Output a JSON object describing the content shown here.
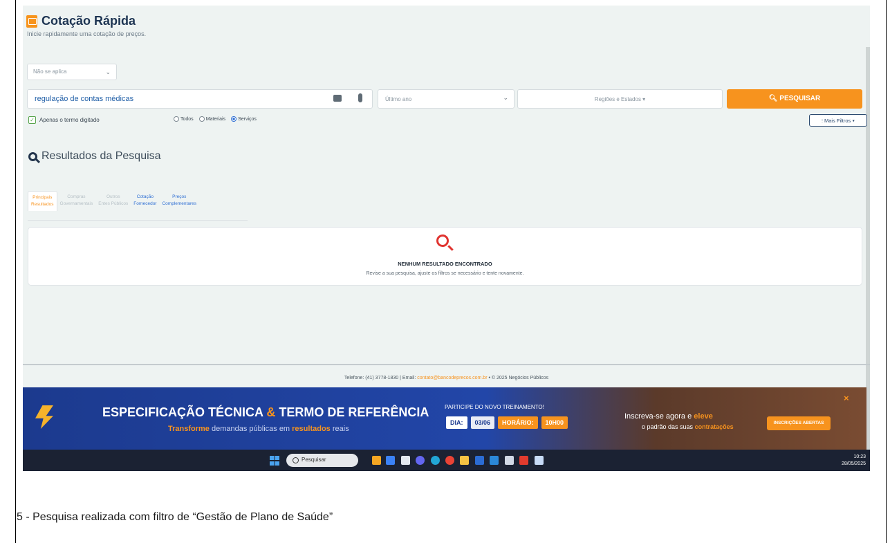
{
  "header": {
    "title": "Cotação Rápida",
    "subtitle": "Inicie rapidamente uma cotação de preços."
  },
  "filters": {
    "applicability": "Não se aplica",
    "search_value": "regulação de contas médicas",
    "period": "Último ano",
    "regions": "Regiões e Estados ▾",
    "search_button": "PESQUISAR",
    "exact_term_label": "Apenas o termo digitado",
    "exact_term_checked": true,
    "radio_options": [
      {
        "label": "Todos",
        "selected": false
      },
      {
        "label": "Materiais",
        "selected": false
      },
      {
        "label": "Serviços",
        "selected": true
      }
    ],
    "more_filters": "Mais Filtros ▾"
  },
  "results": {
    "heading": "Resultados da Pesquisa",
    "tabs": [
      {
        "line1": "Principais",
        "line2": "Resultados",
        "state": "active"
      },
      {
        "line1": "Compras",
        "line2": "Governamentais",
        "state": "disabled"
      },
      {
        "line1": "Outros",
        "line2": "Entes Públicos",
        "state": "disabled"
      },
      {
        "line1": "Cotação",
        "line2": "Fornecedor",
        "state": "link"
      },
      {
        "line1": "Preços",
        "line2": "Complementares",
        "state": "link"
      }
    ],
    "empty_title": "NENHUM RESULTADO ENCONTRADO",
    "empty_message": "Revise a sua pesquisa, ajuste os filtros se necessário e tente novamente."
  },
  "footer": {
    "contact_prefix": "Telefone: (41) 3778-1830 | Email: ",
    "email": "contato@bancodeprecos.com.br",
    "copyright_suffix": " • © 2025 Negócios Públicos"
  },
  "banner": {
    "title_part1": "ESPECIFICAÇÃO TÉCNICA ",
    "title_amp": "&",
    "title_part2": " TERMO DE REFERÊNCIA",
    "sub_hl1": "Transforme",
    "sub_mid": " demandas públicas em ",
    "sub_hl2": "resultados",
    "sub_end": " reais",
    "training": "PARTICIPE DO NOVO TREINAMENTO!",
    "day_label": "DIA:",
    "day_value": "03/06",
    "time_label": "HORÁRIO:",
    "time_value": "10H00",
    "invite_line1a": "Inscreva-se agora e ",
    "invite_line1b": "eleve",
    "invite_line2a": "o padrão das suas ",
    "invite_line2b": "contratações",
    "cta": "INSCRIÇÕES ABERTAS",
    "close": "×"
  },
  "taskbar": {
    "search_placeholder": "Pesquisar",
    "time": "10:23",
    "date": "28/05/2025"
  },
  "caption": "5 - Pesquisa realizada com filtro de “Gestão de Plano de Saúde”",
  "colors": {
    "accent": "#f7931e",
    "title": "#1e3553",
    "banner_bg": "#1c3a8e"
  }
}
